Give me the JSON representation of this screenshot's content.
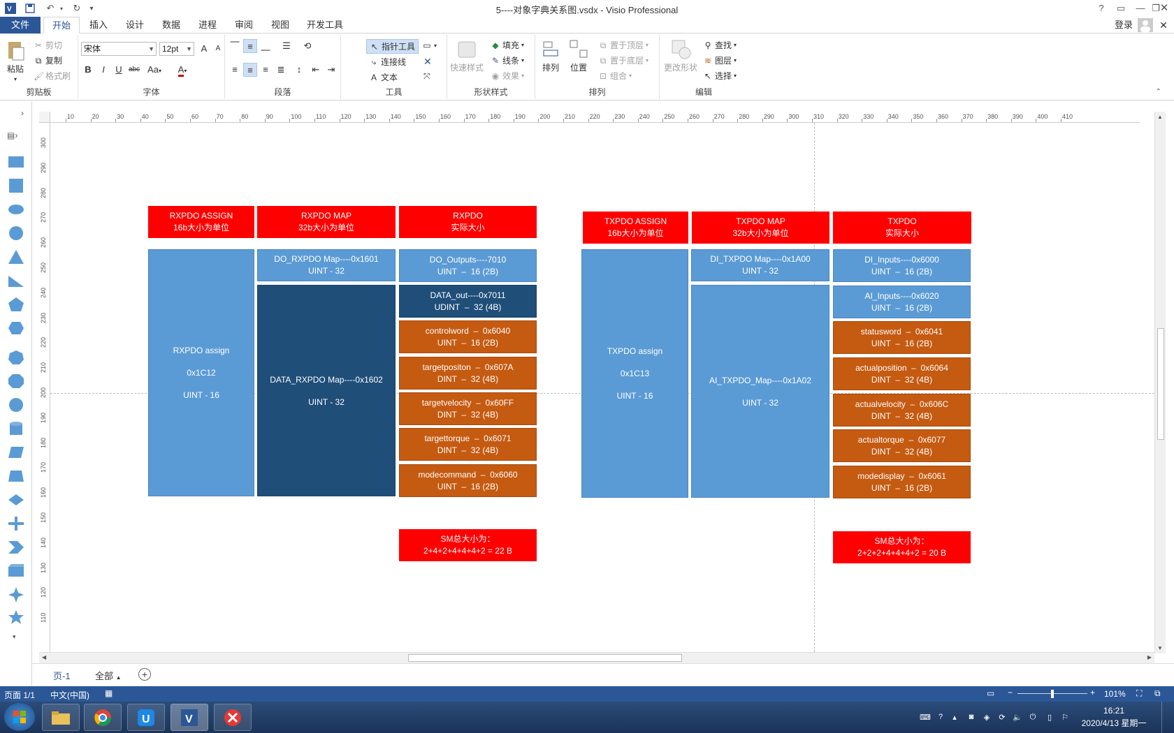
{
  "window": {
    "title": "5----对象字典关系图.vsdx - Visio Professional",
    "help": "?",
    "login": "登录"
  },
  "tabs": [
    "文件",
    "开始",
    "插入",
    "设计",
    "数据",
    "进程",
    "审阅",
    "视图",
    "开发工具"
  ],
  "ribbon": {
    "clipboard": {
      "label": "剪贴板",
      "paste": "粘贴",
      "cut": "剪切",
      "copy": "复制",
      "format_painter": "格式刷"
    },
    "font": {
      "label": "字体",
      "name": "宋体",
      "size": "12pt",
      "case": "Aa",
      "grow": "A",
      "shrink": "A"
    },
    "paragraph": {
      "label": "段落"
    },
    "tools": {
      "label": "工具",
      "pointer": "指针工具",
      "connector": "连接线",
      "text": "文本"
    },
    "shape_styles": {
      "label": "形状样式",
      "quick_styles": "快速样式",
      "fill": "填充",
      "line": "线条",
      "effects": "效果"
    },
    "arrange": {
      "label": "排列",
      "align": "排列",
      "position": "位置",
      "bring_front": "置于顶层",
      "send_back": "置于底层",
      "group": "组合"
    },
    "editing": {
      "label": "编辑",
      "change_shape": "更改形状",
      "find": "查找",
      "layers": "图层",
      "select": "选择"
    }
  },
  "ruler": {
    "h": [
      "10",
      "20",
      "30",
      "40",
      "50",
      "60",
      "70",
      "80",
      "90",
      "100",
      "110",
      "120",
      "130",
      "140",
      "150",
      "160",
      "170",
      "180",
      "190",
      "200",
      "210",
      "220",
      "230",
      "240",
      "250",
      "260",
      "270",
      "280",
      "290",
      "300",
      "310",
      "320",
      "330",
      "340",
      "350",
      "360",
      "370",
      "380",
      "390",
      "400",
      "410"
    ],
    "v": [
      "300",
      "290",
      "280",
      "270",
      "260",
      "250",
      "240",
      "230",
      "220",
      "210",
      "200",
      "190",
      "180",
      "170",
      "160",
      "150",
      "140",
      "130",
      "120",
      "110"
    ]
  },
  "diagram": {
    "rx_headers": [
      {
        "title": "RXPDO ASSIGN",
        "sub": "16b大小为单位"
      },
      {
        "title": "RXPDO MAP",
        "sub": "32b大小为单位"
      },
      {
        "title": "RXPDO",
        "sub": "实际大小"
      }
    ],
    "tx_headers": [
      {
        "title": "TXPDO ASSIGN",
        "sub": "16b大小为单位"
      },
      {
        "title": "TXPDO MAP",
        "sub": "32b大小为单位"
      },
      {
        "title": "TXPDO",
        "sub": "实际大小"
      }
    ],
    "rx_assign": {
      "l1": "RXPDO assign",
      "l2": "0x1C12",
      "l3": "UINT - 16"
    },
    "rx_map1": {
      "l1": "DO_RXPDO Map----0x1601",
      "l2": "UINT - 32"
    },
    "rx_map2": {
      "l1": "DATA_RXPDO Map----0x1602",
      "l2": "UINT - 32"
    },
    "rx_objects": [
      {
        "l1": "DO_Outputs----7010",
        "l2": "UINT  –  16 (2B)"
      },
      {
        "l1": "DATA_out----0x7011",
        "l2": "UDINT  –  32 (4B)"
      },
      {
        "l1": "controlword  –  0x6040",
        "l2": "UINT  –  16 (2B)"
      },
      {
        "l1": "targetpositon  –  0x607A",
        "l2": "DINT  –  32 (4B)"
      },
      {
        "l1": "targetvelocity  –  0x60FF",
        "l2": "DINT  –  32 (4B)"
      },
      {
        "l1": "targettorque  –  0x6071",
        "l2": "DINT  –  32 (4B)"
      },
      {
        "l1": "modecommand  –  0x6060",
        "l2": "UINT  –  16 (2B)"
      }
    ],
    "tx_assign": {
      "l1": "TXPDO assign",
      "l2": "0x1C13",
      "l3": "UINT - 16"
    },
    "tx_map1": {
      "l1": "DI_TXPDO Map----0x1A00",
      "l2": "UINT - 32"
    },
    "tx_map2": {
      "l1": "AI_TXPDO_Map----0x1A02",
      "l2": "UINT - 32"
    },
    "tx_objects": [
      {
        "l1": "DI_Inputs----0x6000",
        "l2": "UINT  –  16 (2B)"
      },
      {
        "l1": "AI_Inputs----0x6020",
        "l2": "UINT  –  16 (2B)"
      },
      {
        "l1": "statusword  –  0x6041",
        "l2": "UINT  –  16 (2B)"
      },
      {
        "l1": "actualposition  –  0x6064",
        "l2": "DINT  –  32 (4B)"
      },
      {
        "l1": "actualvelocity  –  0x606C",
        "l2": "DINT  –  32 (4B)"
      },
      {
        "l1": "actualtorque  –  0x6077",
        "l2": "DINT  –  32 (4B)"
      },
      {
        "l1": "modedisplay  –  0x6061",
        "l2": "UINT  –  16 (2B)"
      }
    ],
    "rx_sum": {
      "l1": "SM总大小为：",
      "l2": "2+4+2+4+4+4+2 = 22 B"
    },
    "tx_sum": {
      "l1": "SM总大小为：",
      "l2": "2+2+2+4+4+4+2 = 20 B"
    }
  },
  "pages": {
    "page1": "页-1",
    "all": "全部"
  },
  "status": {
    "page": "页面 1/1",
    "lang": "中文(中国)",
    "zoom": "101%"
  },
  "taskbar": {
    "time": "16:21",
    "date": "2020/4/13 星期一"
  },
  "colors": {
    "red": "#ff0000",
    "light_blue": "#5b9bd5",
    "dark_blue": "#1f4e79",
    "orange": "#c55a11",
    "accent": "#2b5797"
  }
}
